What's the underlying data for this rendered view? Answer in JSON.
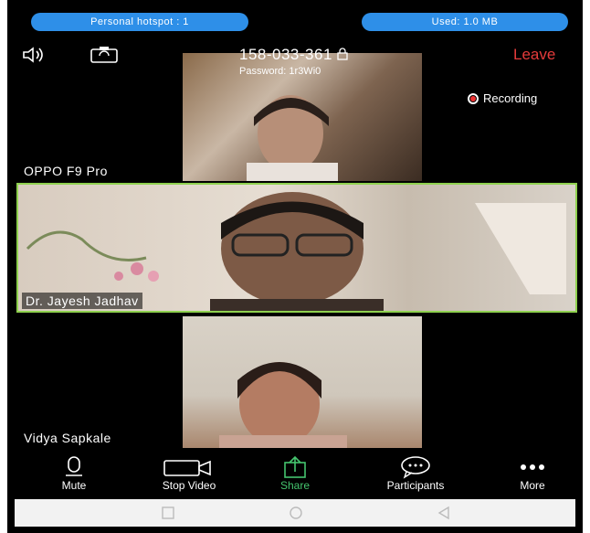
{
  "status": {
    "hotspot": "Personal hotspot : 1",
    "data_used": "Used: 1.0 MB"
  },
  "meeting": {
    "id": "158-033-361",
    "password": "Password: 1r3Wi0",
    "leave_label": "Leave"
  },
  "recording": {
    "label": "Recording"
  },
  "participants": [
    {
      "name": "OPPO F9 Pro"
    },
    {
      "name": "Dr. Jayesh Jadhav"
    },
    {
      "name": "Vidya Sapkale"
    }
  ],
  "toolbar": {
    "mute": "Mute",
    "stop_video": "Stop Video",
    "share": "Share",
    "participants": "Participants",
    "more": "More"
  },
  "colors": {
    "accent_blue": "#2e8fe8",
    "leave_red": "#e53b3b",
    "share_green": "#45c46e",
    "active_border": "#8fd14f"
  },
  "icons": [
    "speaker-icon",
    "switch-camera-icon",
    "lock-icon",
    "record-icon",
    "microphone-icon",
    "video-camera-icon",
    "share-icon",
    "chat-bubble-icon",
    "more-dots-icon",
    "nav-square-icon",
    "nav-circle-icon",
    "nav-back-icon"
  ]
}
